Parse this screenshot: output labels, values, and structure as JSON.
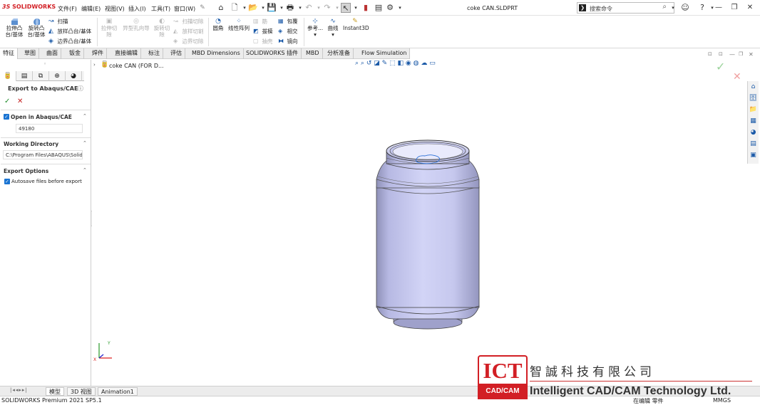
{
  "app": {
    "logo_prefix": "3S",
    "logo_text": "SOLIDWORKS",
    "document_title": "coke CAN.SLDPRT"
  },
  "menu": [
    "文件(F)",
    "编辑(E)",
    "视图(V)",
    "插入(I)",
    "工具(T)",
    "窗口(W)"
  ],
  "search": {
    "placeholder": "搜索命令"
  },
  "command_manager": {
    "extrude_boss": [
      "拉伸凸",
      "台/基体"
    ],
    "revolve_boss": [
      "旋转凸",
      "台/基体"
    ],
    "sweep": "扫描",
    "loft": "放样凸台/基体",
    "boundary": "边界凸台/基体",
    "extrude_cut": [
      "拉伸切",
      "除"
    ],
    "hole_wizard": "异型孔向导",
    "revolve_cut": [
      "旋转切",
      "除"
    ],
    "sweep_cut": "扫描切除",
    "loft_cut": "放样切割",
    "boundary_cut": "边界切除",
    "fillet": "圆角",
    "linear_pattern": "线性阵列",
    "rib": "筋",
    "draft": "拔模",
    "shell": "抽壳",
    "wrap": "包覆",
    "intersect": "相交",
    "mirror": "镜向",
    "reference": "参考...",
    "curves": "曲线",
    "instant3d": "Instant3D"
  },
  "tabs": [
    "特征",
    "草图",
    "曲面",
    "钣金",
    "焊件",
    "直接编辑",
    "标注",
    "评估",
    "MBD Dimensions",
    "SOLIDWORKS 插件",
    "MBD",
    "分析准备",
    "Flow Simulation"
  ],
  "property_manager": {
    "title": "Export to Abaqus/CAE",
    "open_in_abaqus": {
      "label": "Open in Abaqus/CAE",
      "value": "49180"
    },
    "working_directory": {
      "label": "Working Directory",
      "value": "C:\\Program Files\\ABAQUS\\SolidW"
    },
    "export_options": {
      "label": "Export Options",
      "autosave_label": "Autosave files before export"
    }
  },
  "feature_tree": {
    "root_label": "coke CAN  (FOR D..."
  },
  "bottom_tabs": [
    "模型",
    "3D 视图",
    "Animation1"
  ],
  "status": {
    "version": "SOLIDWORKS Premium 2021 SP5.1",
    "editing": "在编辑 零件",
    "units": "MMGS"
  },
  "watermark": {
    "ict": "ICT",
    "ict_sub": "CAD/CAM",
    "chinese": "智誠科技有限公司",
    "english": "Intelligent CAD/CAM Technology Ltd."
  },
  "colors": {
    "brand_red": "#d21f25",
    "can_body": "#c7c9ef",
    "checkbox_blue": "#1a74d2",
    "tab_bg": "#ececec"
  }
}
